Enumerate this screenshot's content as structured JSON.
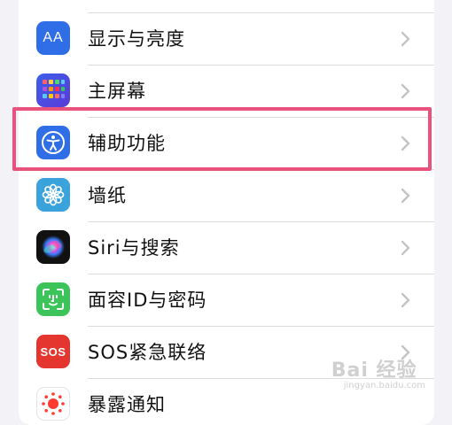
{
  "settings": {
    "items": [
      {
        "label": "显示与亮度",
        "icon": "display-brightness-icon"
      },
      {
        "label": "主屏幕",
        "icon": "home-screen-icon"
      },
      {
        "label": "辅助功能",
        "icon": "accessibility-icon"
      },
      {
        "label": "墙纸",
        "icon": "wallpaper-icon"
      },
      {
        "label": "Siri与搜索",
        "icon": "siri-icon"
      },
      {
        "label": "面容ID与密码",
        "icon": "face-id-icon"
      },
      {
        "label": "SOS紧急联络",
        "icon": "sos-icon"
      },
      {
        "label": "暴露通知",
        "icon": "exposure-notification-icon"
      }
    ],
    "display_icon_text": "AA",
    "sos_icon_text": "SOS"
  },
  "colors": {
    "highlight": "#e8527c",
    "display_icon_bg": "#2f6ee6",
    "accessibility_icon_bg": "#2f6ee6",
    "wallpaper_icon_bg": "#3aa3dc",
    "faceid_icon_bg": "#3cc45a",
    "sos_icon_bg": "#e4362e"
  },
  "watermark": {
    "main": "Bai 经验",
    "sub": "jingyan.baidu.com"
  }
}
